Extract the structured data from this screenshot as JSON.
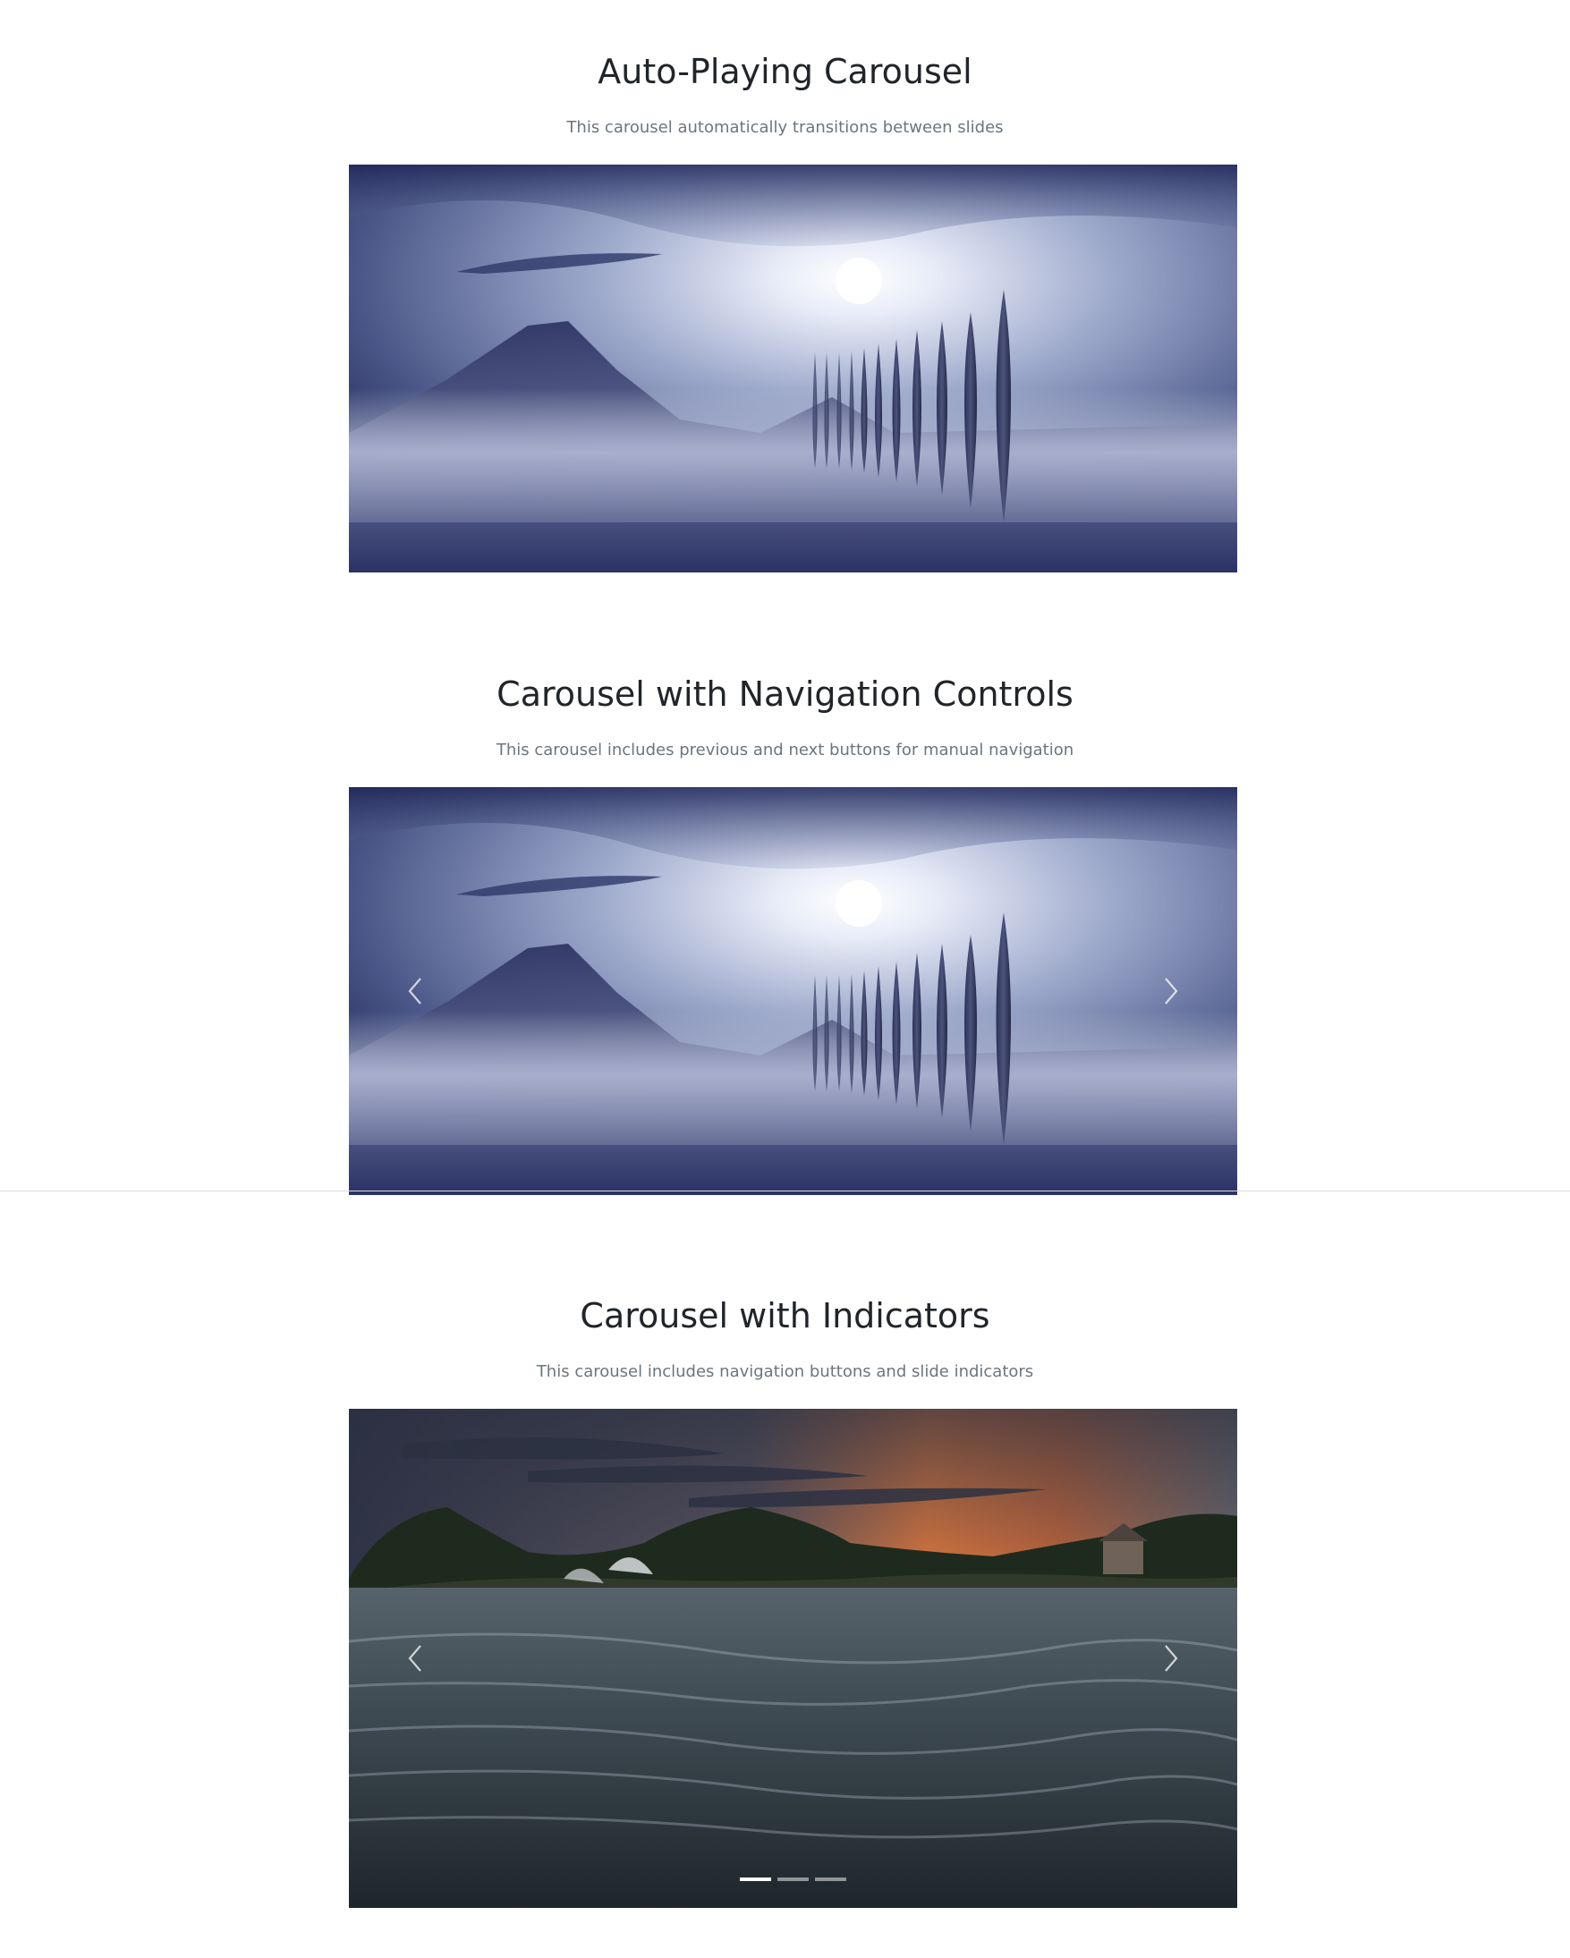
{
  "sections": {
    "autoplay": {
      "title": "Auto-Playing Carousel",
      "subtitle": "This carousel automatically transitions between slides"
    },
    "navigation": {
      "title": "Carousel with Navigation Controls",
      "subtitle": "This carousel includes previous and next buttons for manual navigation",
      "prev_icon": "chevron-left-icon",
      "next_icon": "chevron-right-icon"
    },
    "indicators": {
      "title": "Carousel with Indicators",
      "subtitle": "This carousel includes navigation buttons and slide indicators",
      "prev_icon": "chevron-left-icon",
      "next_icon": "chevron-right-icon",
      "indicator_count": 3,
      "active_indicator": 1
    }
  },
  "colors": {
    "title": "#212529",
    "subtitle": "#6c757d",
    "divider": "#dcdcdc"
  }
}
